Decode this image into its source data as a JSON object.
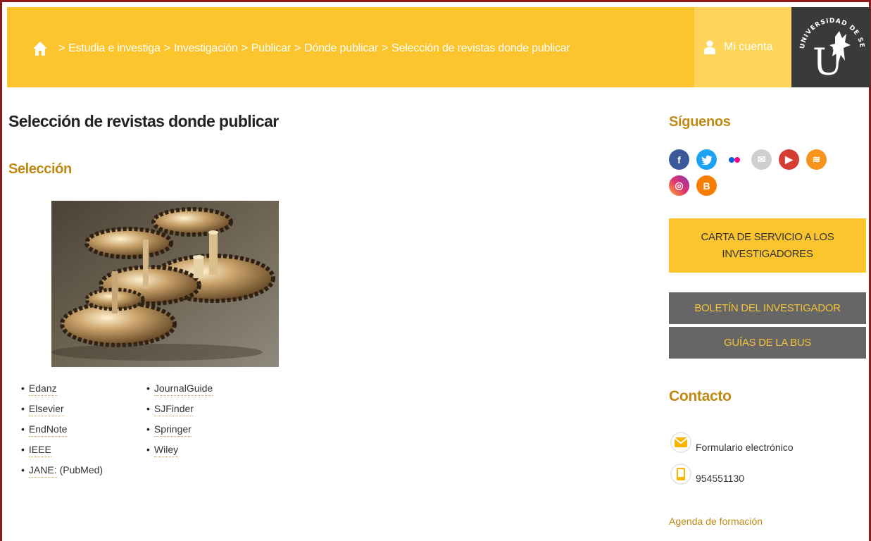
{
  "header": {
    "breadcrumb": [
      "Estudia e investiga",
      "Investigación",
      "Publicar",
      "Dónde publicar",
      "Selección de revistas donde publicar"
    ],
    "separator": ">",
    "account_label": "Mi cuenta",
    "logo_text": "UNIVERSIDAD DE SEVILLA",
    "logo_letter": "U"
  },
  "main": {
    "title": "Selección de revistas donde publicar",
    "section_title": "Selección",
    "list_left": [
      {
        "label": "Edanz",
        "extra": ""
      },
      {
        "label": "Elsevier",
        "extra": ""
      },
      {
        "label": "EndNote",
        "extra": ""
      },
      {
        "label": "IEEE",
        "extra": ""
      },
      {
        "label": "JANE:",
        "extra": "(PubMed)"
      }
    ],
    "list_right": [
      {
        "label": "JournalGuide"
      },
      {
        "label": "SJFinder"
      },
      {
        "label": "Springer"
      },
      {
        "label": "Wiley"
      }
    ],
    "bullet": "•"
  },
  "sidebar": {
    "follow_title": "Síguenos",
    "social": [
      {
        "name": "facebook-icon",
        "glyph": "f",
        "color": "#3b5998"
      },
      {
        "name": "twitter-icon",
        "glyph": "t",
        "color": "#1da1f2"
      },
      {
        "name": "flickr-icon",
        "glyph": "",
        "color": "#ffffff"
      },
      {
        "name": "email-icon",
        "glyph": "✉",
        "color": "#cfcfcf"
      },
      {
        "name": "youtube-icon",
        "glyph": "▶",
        "color": "#d43d31"
      },
      {
        "name": "rss-icon",
        "glyph": "≋",
        "color": "#f7941d"
      },
      {
        "name": "instagram-icon",
        "glyph": "◎",
        "color": "#c13584"
      },
      {
        "name": "blogger-icon",
        "glyph": "B",
        "color": "#f57d00"
      }
    ],
    "carta_line1": "CARTA DE SERVICIO A LOS",
    "carta_line2": "INVESTIGADORES",
    "boletin": "BOLETÍN DEL INVESTIGADOR",
    "guias": "GUÍAS DE LA BUS",
    "contact_title": "Contacto",
    "form_label": "Formulario electrónico",
    "phone": "954551130",
    "agenda": "Agenda de formación"
  },
  "colors": {
    "brand_yellow": "#fcc42d",
    "accent_gold": "#c08a12",
    "dark_grey": "#666666"
  }
}
